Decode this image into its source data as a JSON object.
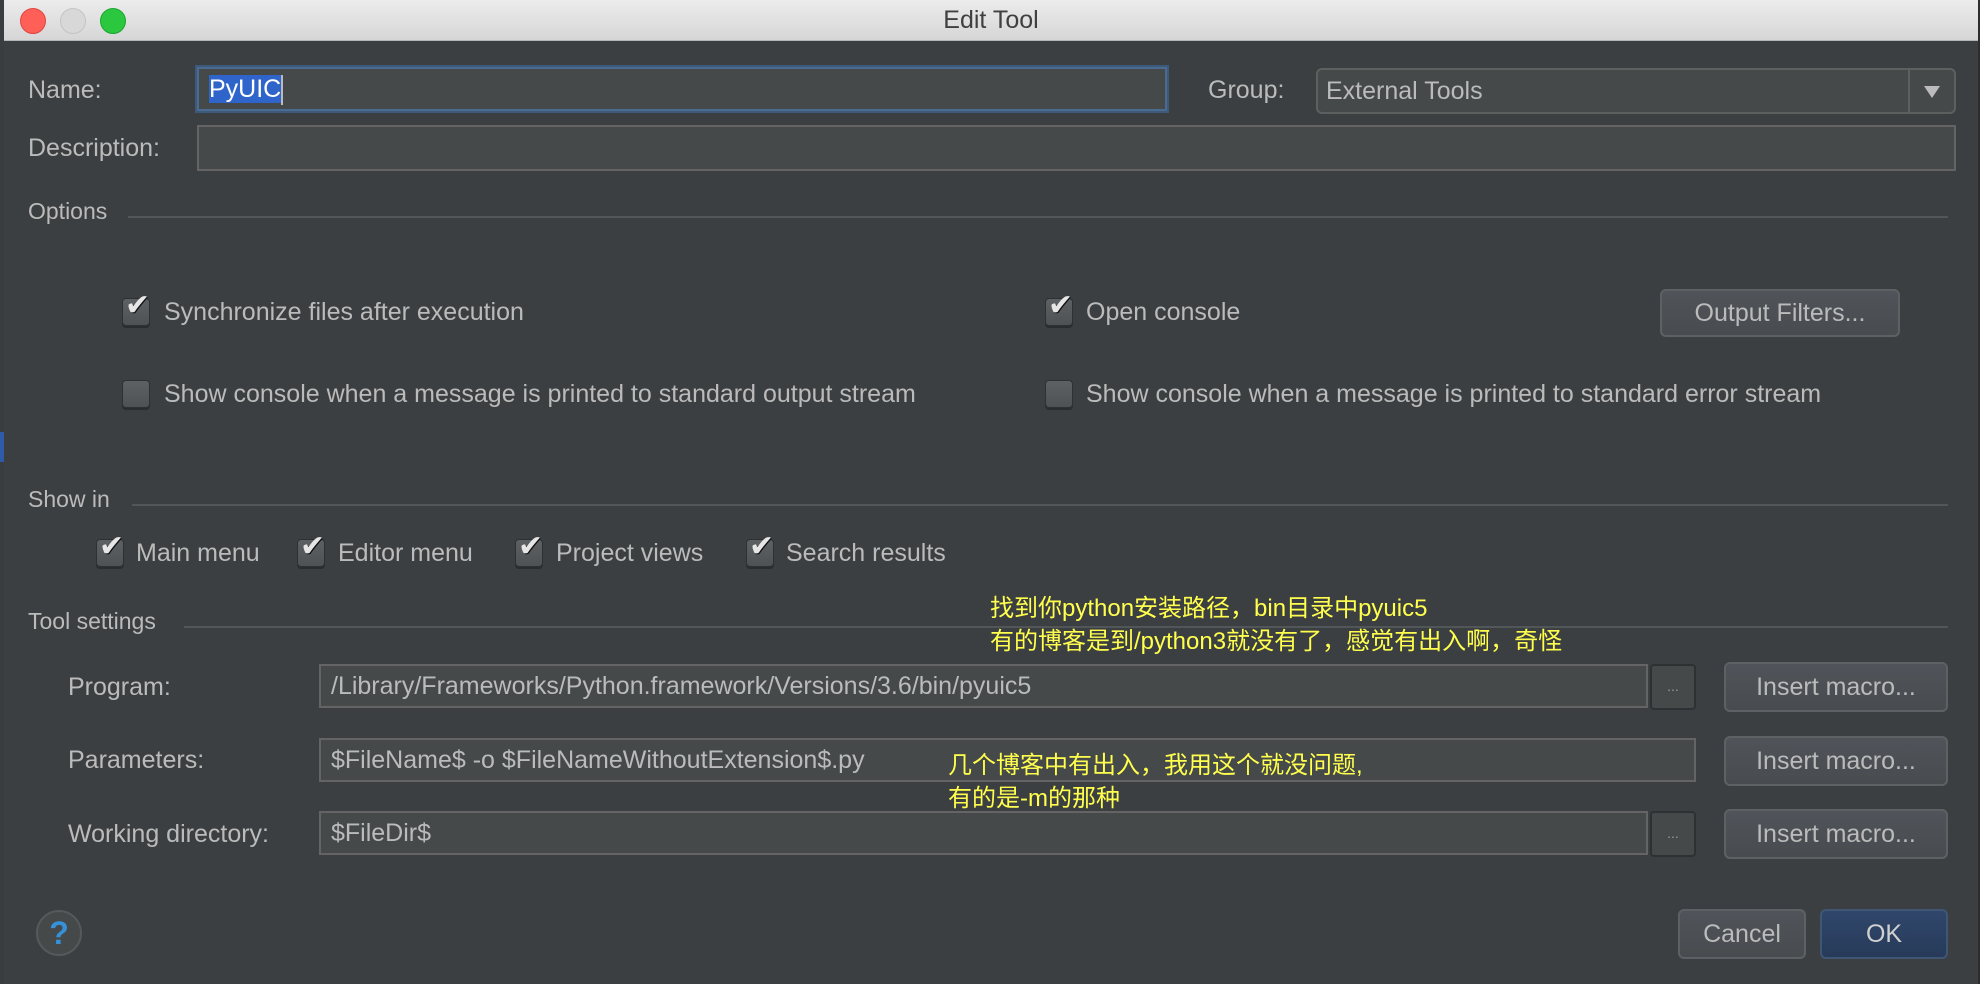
{
  "window": {
    "title": "Edit Tool",
    "controls": [
      "close",
      "minimize",
      "maximize"
    ]
  },
  "form": {
    "name_label": "Name:",
    "name_value": "PyUIC",
    "group_label": "Group:",
    "group_value": "External Tools",
    "description_label": "Description:",
    "description_value": ""
  },
  "options": {
    "header": "Options",
    "sync_files": {
      "label": "Synchronize files after execution",
      "checked": true
    },
    "open_console": {
      "label": "Open console",
      "checked": true
    },
    "output_filters_button": "Output Filters...",
    "show_console_stdout": {
      "label": "Show console when a message is printed to standard output stream",
      "checked": false
    },
    "show_console_stderr": {
      "label": "Show console when a message is printed to standard error stream",
      "checked": false
    }
  },
  "show_in": {
    "header": "Show in",
    "items": [
      {
        "label": "Main menu",
        "checked": true
      },
      {
        "label": "Editor menu",
        "checked": true
      },
      {
        "label": "Project views",
        "checked": true
      },
      {
        "label": "Search results",
        "checked": true
      }
    ]
  },
  "tool_settings": {
    "header": "Tool settings",
    "program_label": "Program:",
    "program_value": "/Library/Frameworks/Python.framework/Versions/3.6/bin/pyuic5",
    "parameters_label": "Parameters:",
    "parameters_value": "$FileName$ -o $FileNameWithoutExtension$.py",
    "working_dir_label": "Working directory:",
    "working_dir_value": "$FileDir$",
    "browse_label": "...",
    "insert_macro_label": "Insert macro..."
  },
  "annotations": {
    "program_note_line1": "找到你python安装路径，bin目录中pyuic5",
    "program_note_line2": "有的博客是到/python3就没有了，感觉有出入啊，奇怪",
    "parameters_note_line1": "几个博客中有出入，我用这个就没问题,",
    "parameters_note_line2": "有的是-m的那种",
    "color": "#ffff4d"
  },
  "footer": {
    "help_glyph": "?",
    "cancel_label": "Cancel",
    "ok_label": "OK"
  },
  "colors": {
    "dialog_bg": "#3c3f41",
    "field_bg": "#45494a",
    "selection": "#2f65ca",
    "ok_button": "#2b4062",
    "help_icon": "#3592d8"
  }
}
